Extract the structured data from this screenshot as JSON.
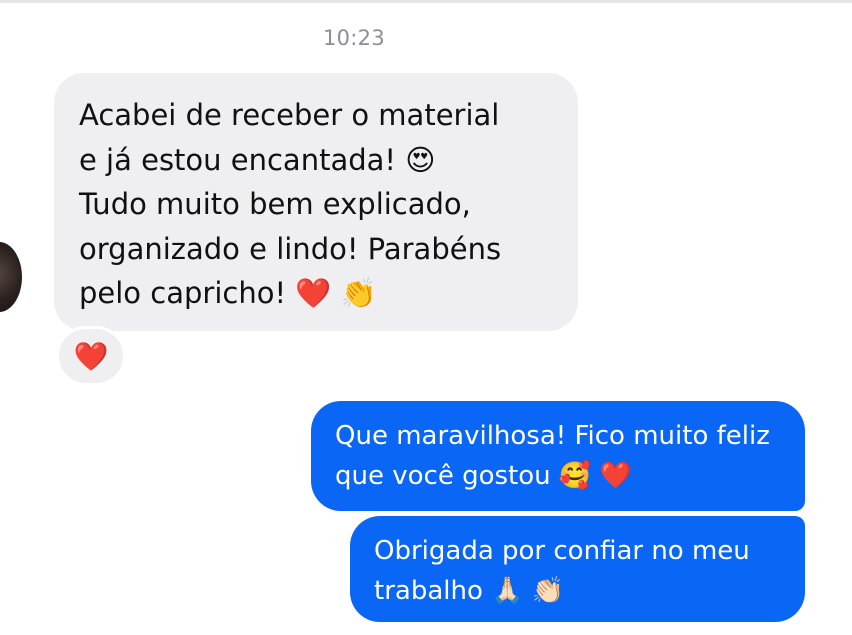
{
  "conversation": {
    "timestamp": "10:23",
    "incoming": {
      "text": "Acabei de receber o material\ne já estou encantada! 😍\nTudo muito bem explicado,\norganizado e lindo! Parabéns\npelo capricho! ❤️ 👏",
      "reaction": "❤️"
    },
    "outgoing": [
      {
        "text": "Que maravilhosa! Fico muito feliz\nque você gostou 🥰 ❤️"
      },
      {
        "text": "Obrigada por confiar no meu\ntrabalho 🙏🏻 👏🏻"
      }
    ]
  },
  "colors": {
    "incoming_bubble": "#efeff1",
    "outgoing_bubble": "#0a66f5",
    "timestamp": "#8e8e93"
  }
}
